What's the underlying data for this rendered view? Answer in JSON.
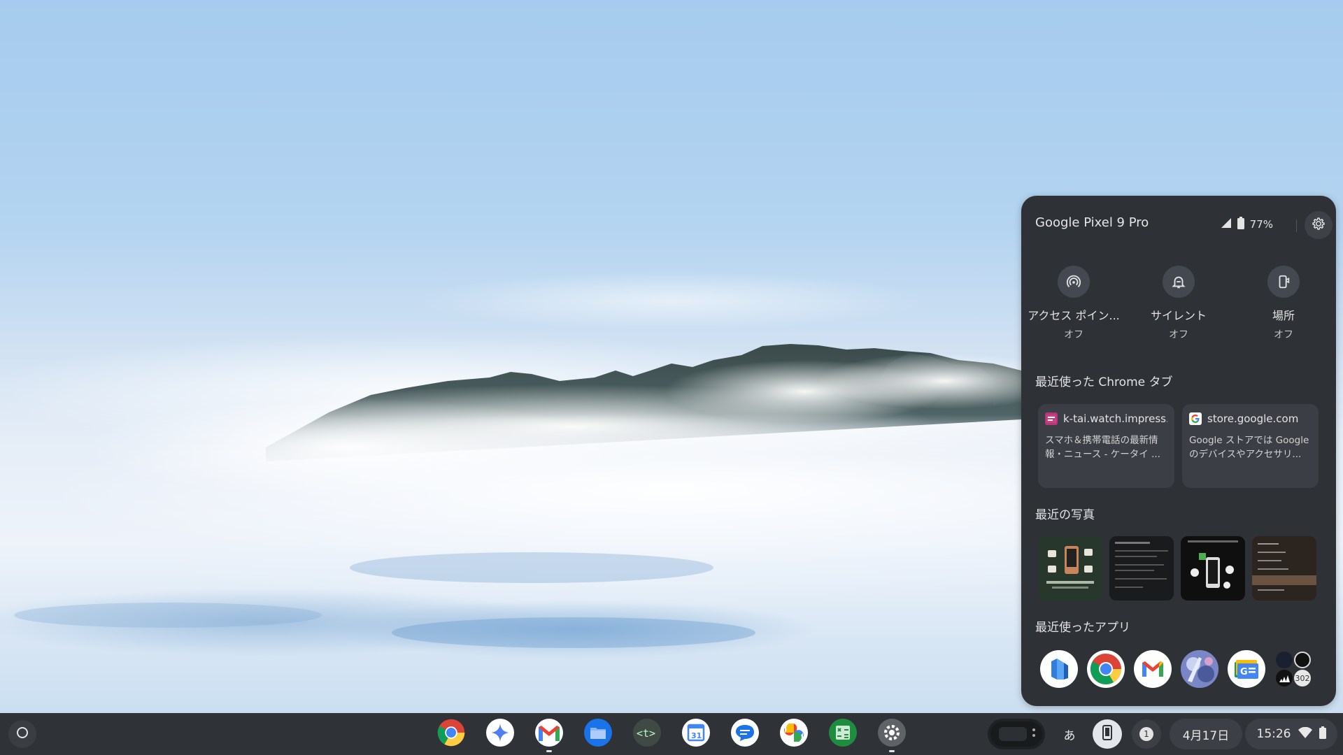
{
  "phone_hub": {
    "device_name": "Google Pixel 9 Pro",
    "battery": "77%",
    "quick_actions": [
      {
        "label": "アクセス ポイン...",
        "state": "オフ",
        "icon": "hotspot-icon"
      },
      {
        "label": "サイレント",
        "state": "オフ",
        "icon": "silent-bell-icon"
      },
      {
        "label": "場所",
        "state": "オフ",
        "icon": "locate-phone-icon"
      }
    ],
    "recent_tabs_title": "最近使った Chrome タブ",
    "recent_tabs": [
      {
        "domain": "k-tai.watch.impress...",
        "title": "スマホ＆携帯電話の最新情報・ニュース - ケータイ ...",
        "icon": "k-tai-favicon"
      },
      {
        "domain": "store.google.com",
        "title": "Google ストアでは Google のデバイスやアクセサリ...",
        "icon": "google-favicon"
      }
    ],
    "recent_photos_title": "最近の写真",
    "recent_apps_title": "最近使ったアプリ",
    "recent_apps": [
      {
        "name": "app-1",
        "icon": "blue-app-icon"
      },
      {
        "name": "chrome",
        "icon": "chrome-icon"
      },
      {
        "name": "gmail",
        "icon": "gmail-icon"
      },
      {
        "name": "game",
        "icon": "game-app-icon"
      },
      {
        "name": "google-news",
        "icon": "google-news-icon"
      }
    ],
    "more_apps_count": "302"
  },
  "shelf": {
    "apps": [
      {
        "name": "chrome",
        "icon": "chrome-icon",
        "running": false
      },
      {
        "name": "gemini",
        "icon": "gemini-icon",
        "running": false
      },
      {
        "name": "gmail",
        "icon": "gmail-icon",
        "running": true
      },
      {
        "name": "files",
        "icon": "files-icon",
        "running": false
      },
      {
        "name": "terminal",
        "icon": "terminal-icon",
        "running": false
      },
      {
        "name": "calendar",
        "icon": "calendar-icon",
        "running": false
      },
      {
        "name": "messages",
        "icon": "messages-icon",
        "running": false
      },
      {
        "name": "photos",
        "icon": "photos-icon",
        "running": false
      },
      {
        "name": "sheets",
        "icon": "sheets-icon",
        "running": false
      },
      {
        "name": "settings",
        "icon": "settings-icon",
        "running": true
      }
    ],
    "calendar_day": "31",
    "ime_label": "あ",
    "notification_count": "1",
    "date": "4月17日",
    "time": "15:26"
  },
  "colors": {
    "panel_bg": "#2e3136",
    "shelf_bg": "#2f3237",
    "card_bg": "#3b3f45"
  }
}
